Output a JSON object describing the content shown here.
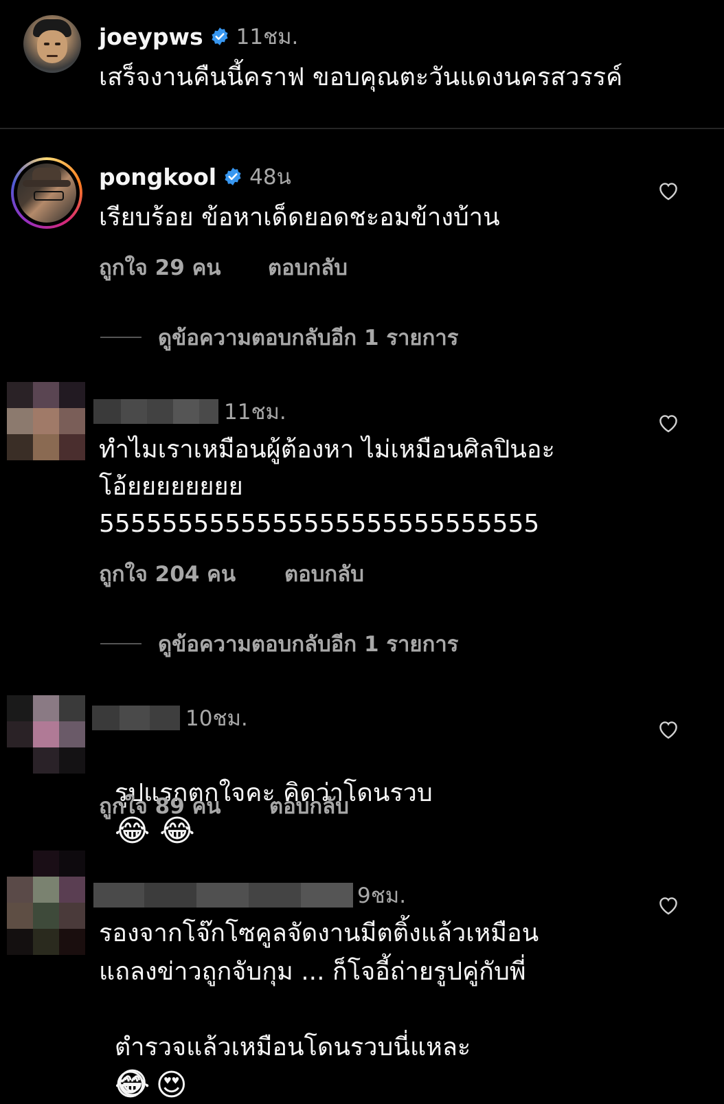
{
  "caption": {
    "username": "joeypws",
    "time": "11ชม.",
    "text": "เสร็จงานคืนนี้คราฟ ขอบคุณตะวันแดงนครสวรรค์"
  },
  "comments": [
    {
      "username": "pongkool",
      "time": "48น",
      "text": "เรียบร้อย ข้อหาเด็ดยอดชะอมข้างบ้าน",
      "likes": "ถูกใจ 29 คน",
      "reply": "ตอบกลับ",
      "view_replies": "ดูข้อความตอบกลับอีก 1 รายการ"
    },
    {
      "username": "",
      "time": "11ชม.",
      "text_line1": "ทำไมเราเหมือนผู้ต้องหา ไม่เหมือนศิลปินอะ",
      "text_line2": "โอ้ยยยยยยยย",
      "text_line3": "5555555555555555555555555555",
      "likes": "ถูกใจ 204 คน",
      "reply": "ตอบกลับ",
      "view_replies": "ดูข้อความตอบกลับอีก 1 รายการ"
    },
    {
      "username": "",
      "time": "10ชม.",
      "text": "รูปแรกตกใจคะ คิดว่าโดนรวบ",
      "emojis": "😂 😂",
      "likes": "ถูกใจ 89 คน",
      "reply": "ตอบกลับ"
    },
    {
      "username": "",
      "time": "9ชม.",
      "text_line1": "รองจากโจ๊กโซคูลจัดงานมีตติ้งแล้วเหมือน",
      "text_line2": "แถลงข่าวถูกจับกุม ... ก็โจอี้ถ่ายรูปคู่กับพี่",
      "text_line3": "ตำรวจแล้วเหมือนโดนรวบนี่แหละ",
      "emojis_line3": "😄 😍",
      "emoji_line4": "😂"
    }
  ],
  "colors": {
    "background": "#000000",
    "text": "#f5f5f5",
    "secondary": "#a8a8a8",
    "verified": "#3897f0",
    "divider": "#262626"
  },
  "icons": {
    "verified": "verified-badge-icon",
    "like": "heart-outline-icon"
  }
}
